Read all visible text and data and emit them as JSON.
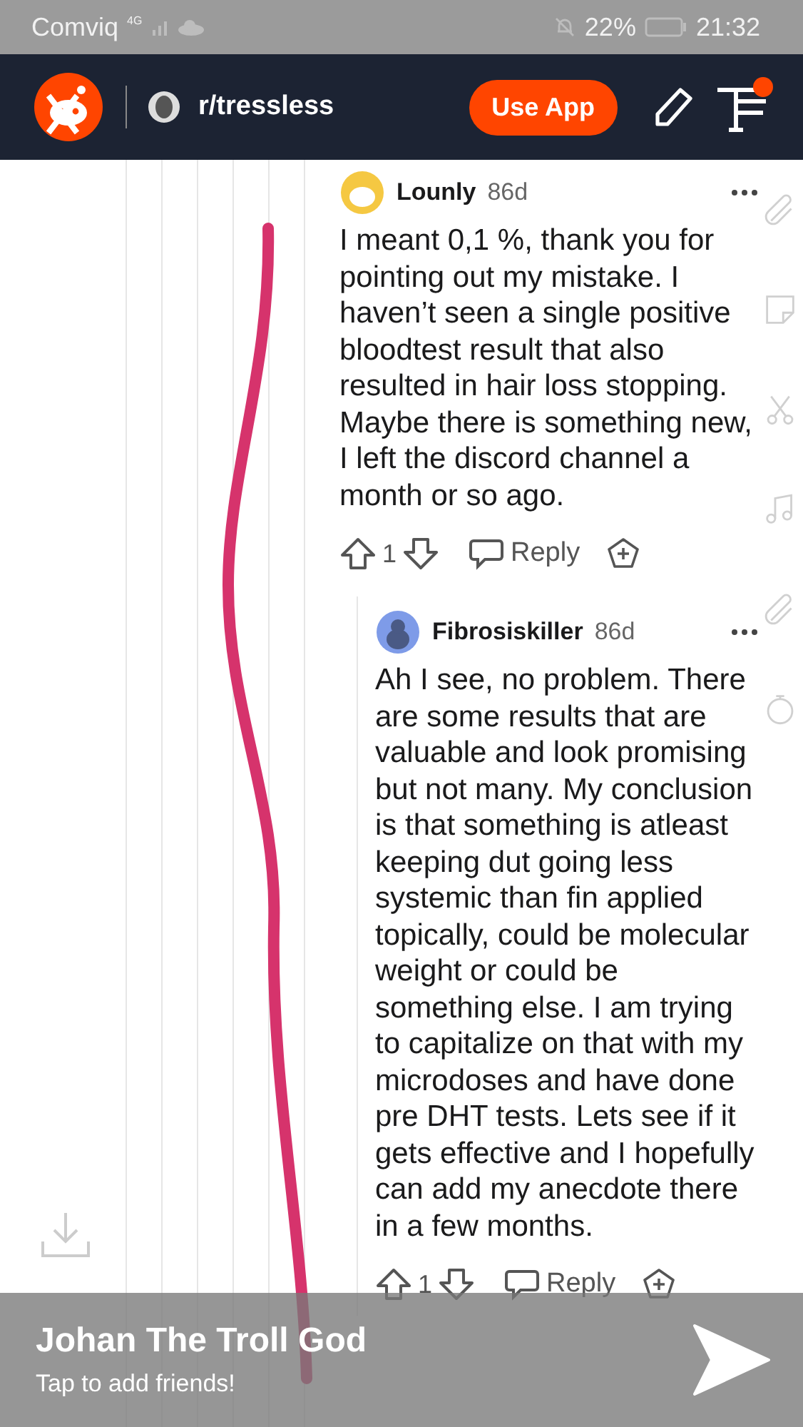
{
  "status_bar": {
    "carrier": "Comviq",
    "network": "4G",
    "battery": "22%",
    "time": "21:32"
  },
  "header": {
    "subreddit": "r/tressless",
    "use_app_button": "Use App",
    "has_notification": true
  },
  "comments": [
    {
      "author": "Lounly",
      "age": "86d",
      "color": "#f5c842",
      "body": "I meant 0,1 %, thank you for pointing out my mistake. I haven’t seen a single positive bloodtest result that also resulted in hair loss stopping. Maybe there is something new, I left the discord channel a month or so ago.",
      "votes": "1",
      "reply_label": "Reply",
      "children": [
        {
          "author": "Fibrosiskiller",
          "age": "86d",
          "color": "#7e9be8",
          "body": "Ah I see, no problem. There are some results that are valuable and look promising but not many. My conclusion is that something is atleast keeping dut going less systemic than fin applied topically, could be molecular weight or could be something else. I am trying to capitalize on that with my microdoses and have done pre DHT tests. Lets see if it gets effective and I hopefully can add my anecdote there in a few months.",
          "votes": "1",
          "reply_label": "Reply"
        }
      ]
    }
  ],
  "snap_overlay": {
    "name": "Johan The Troll God",
    "subtitle": "Tap to add friends!"
  }
}
